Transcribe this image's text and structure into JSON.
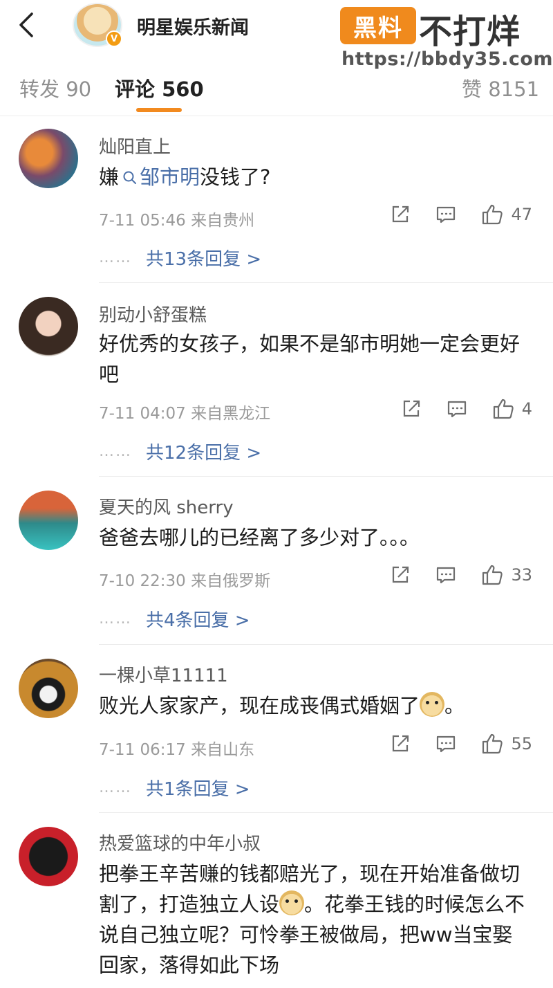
{
  "header": {
    "title": "明星娱乐新闻"
  },
  "watermark": {
    "badge": "黑料",
    "text": "不打烊",
    "url": "https://bbdy35.com"
  },
  "tabs": {
    "reposts": "转发 90",
    "comments": "评论 560",
    "likes": "赞 8151"
  },
  "comments": [
    {
      "username": "灿阳直上",
      "text_before": "嫌",
      "topic": "邹市明",
      "text_after": "没钱了?",
      "meta": "7-11 05:46 来自贵州",
      "likes": "47",
      "replies": "共13条回复 >"
    },
    {
      "username": "别动小舒蛋糕",
      "text": "好优秀的女孩子，如果不是邹市明她一定会更好吧",
      "meta": "7-11 04:07 来自黑龙江",
      "likes": "4",
      "replies": "共12条回复 >"
    },
    {
      "username": "夏天的风 sherry",
      "text": "爸爸去哪儿的已经离了多少对了。。。",
      "meta": "7-10 22:30 来自俄罗斯",
      "likes": "33",
      "replies": "共4条回复 >"
    },
    {
      "username": "一棵小草11111",
      "text_before": "败光人家家产，现在成丧偶式婚姻了",
      "text_after": "。",
      "meta": "7-11 06:17 来自山东",
      "likes": "55",
      "replies": "共1条回复 >"
    },
    {
      "username": "热爱篮球的中年小叔",
      "text_before": "把拳王辛苦赚的钱都赔光了，现在开始准备做切割了，打造独立人设",
      "text_after": "。花拳王钱的时候怎么不说自己独立呢？可怜拳王被做局，把ww当宝娶回家，落得如此下场"
    }
  ],
  "reply_dots": "……"
}
